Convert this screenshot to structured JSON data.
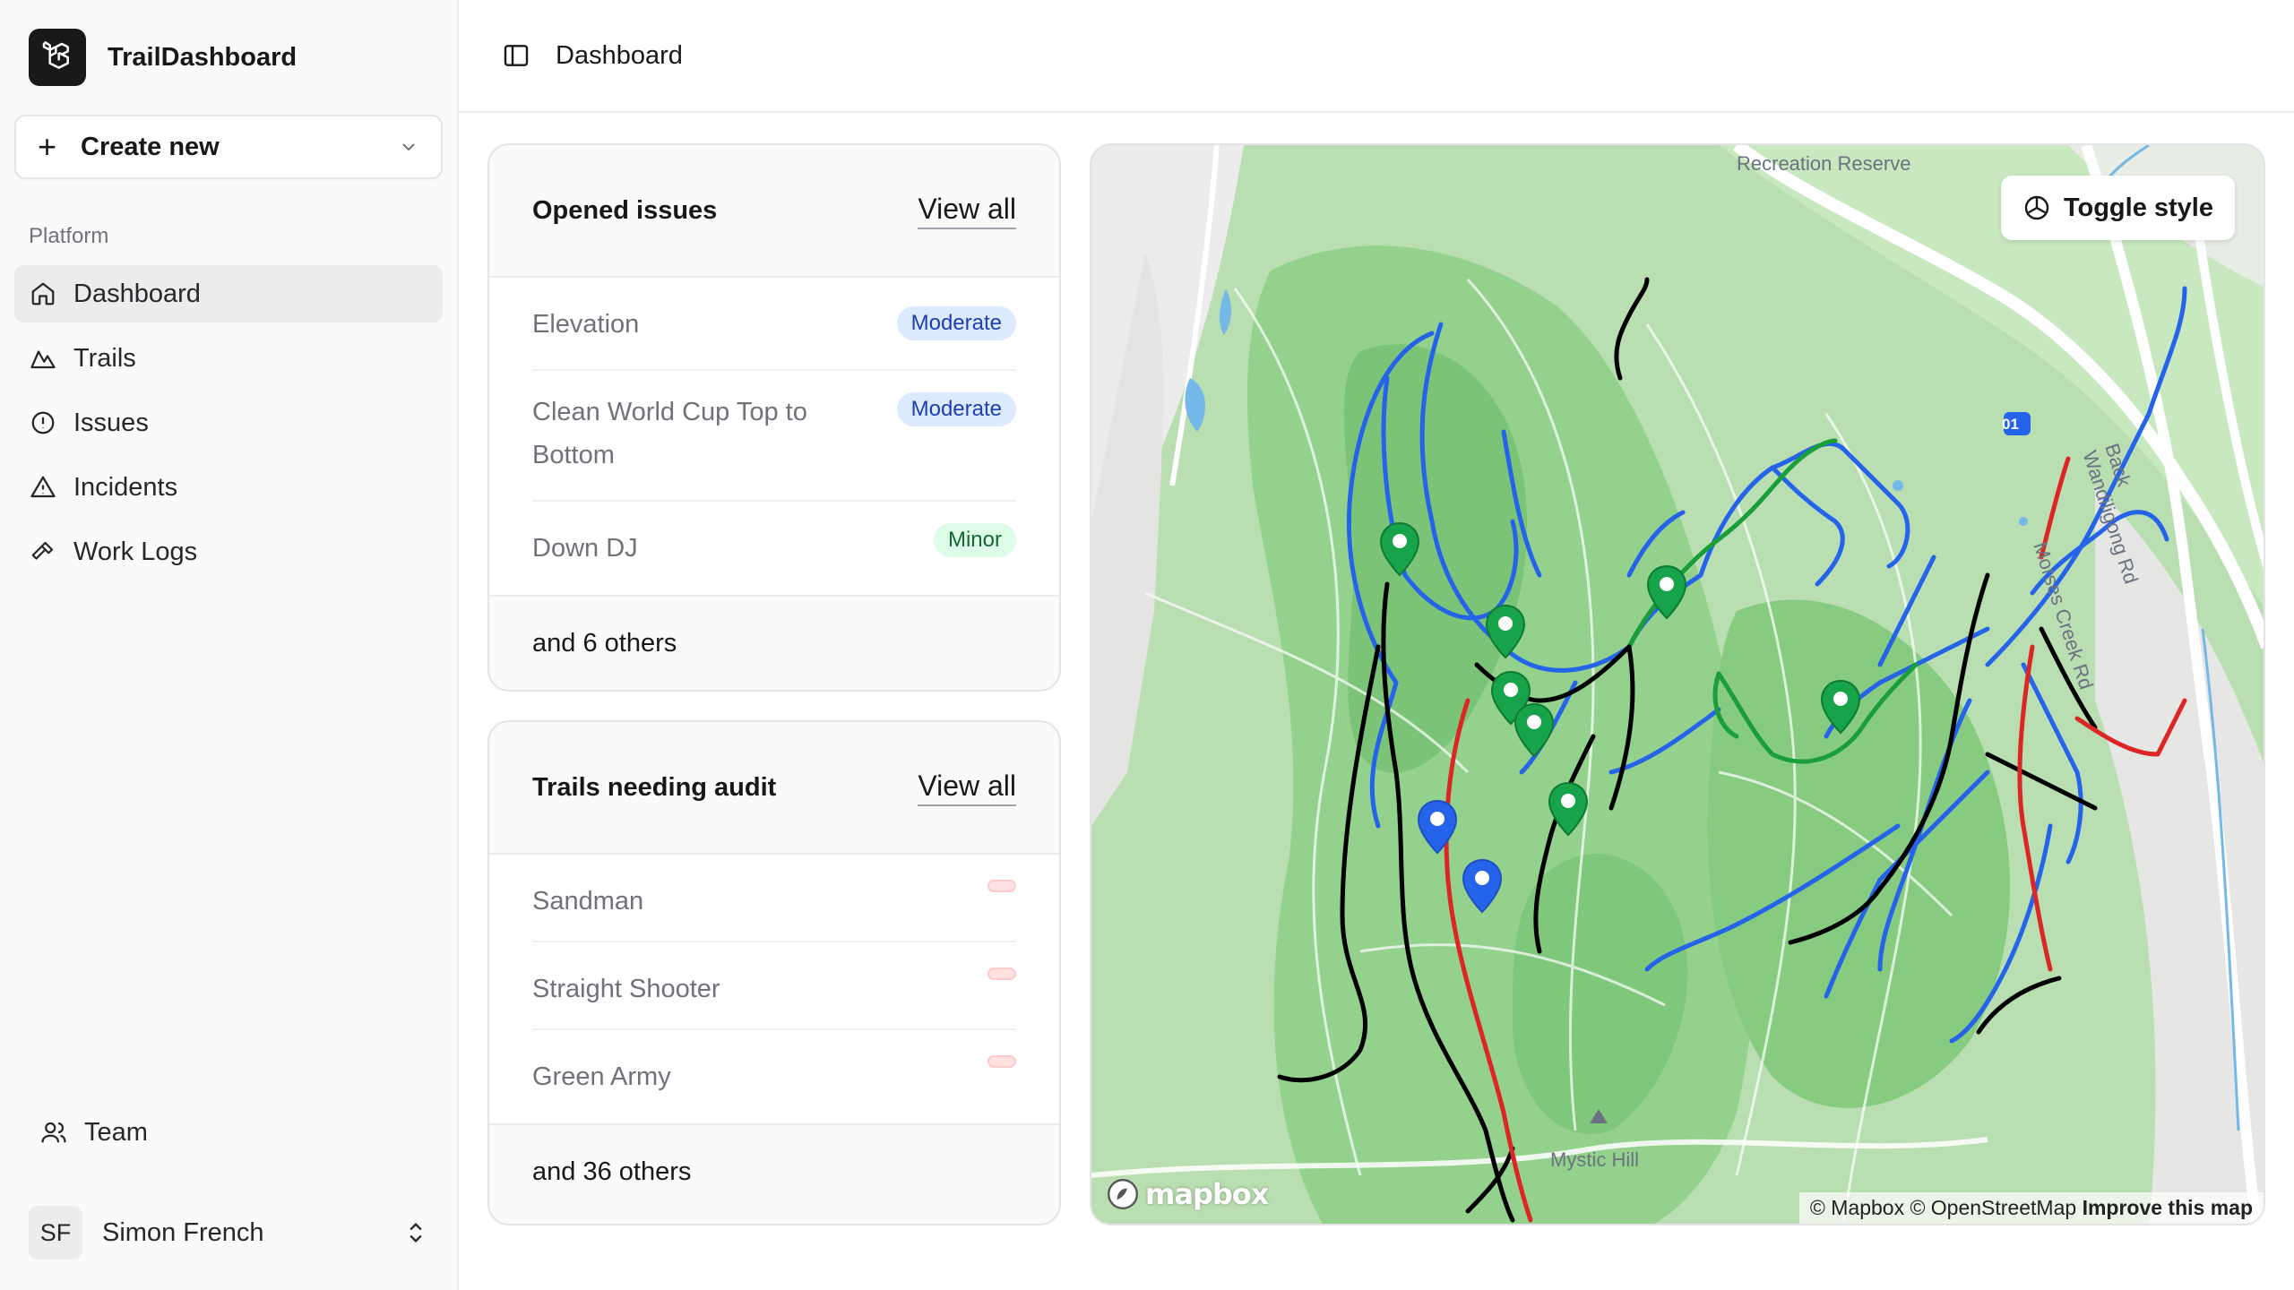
{
  "app": {
    "name": "TrailDashboard"
  },
  "sidebar": {
    "create_label": "Create new",
    "section_label": "Platform",
    "items": [
      {
        "label": "Dashboard",
        "icon": "home-icon",
        "active": true
      },
      {
        "label": "Trails",
        "icon": "mountain-icon"
      },
      {
        "label": "Issues",
        "icon": "alert-circle-icon"
      },
      {
        "label": "Incidents",
        "icon": "warning-triangle-icon"
      },
      {
        "label": "Work Logs",
        "icon": "hammer-icon"
      }
    ],
    "team_label": "Team",
    "user": {
      "initials": "SF",
      "name": "Simon French"
    }
  },
  "topbar": {
    "title": "Dashboard"
  },
  "opened_issues": {
    "title": "Opened issues",
    "view_all": "View all",
    "rows": [
      {
        "name": "Elevation",
        "badge": "Moderate"
      },
      {
        "name": "Clean World Cup Top to Bottom",
        "badge": "Moderate"
      },
      {
        "name": "Down DJ",
        "badge": "Minor"
      }
    ],
    "footer": "and 6 others"
  },
  "trails_audit": {
    "title": "Trails needing audit",
    "view_all": "View all",
    "rows": [
      {
        "name": "Sandman"
      },
      {
        "name": "Straight Shooter"
      },
      {
        "name": "Green Army"
      }
    ],
    "footer": "and 36 others"
  },
  "map": {
    "toggle_label": "Toggle style",
    "labels": {
      "reserve": "Recreation Reserve",
      "road1": "Back Wandiligong Rd",
      "road2": "Morses Creek Rd",
      "hill": "Mystic Hill",
      "route": "01"
    },
    "logo_text": "mapbox",
    "attribution": "© Mapbox © OpenStreetMap",
    "improve": "Improve this map",
    "colors": {
      "green_trail": "#1a9e3a",
      "blue_trail": "#2563eb",
      "red_trail": "#dc2626",
      "black_trail": "#000000",
      "green_pin": "#16a34a",
      "blue_pin": "#2563eb"
    }
  }
}
